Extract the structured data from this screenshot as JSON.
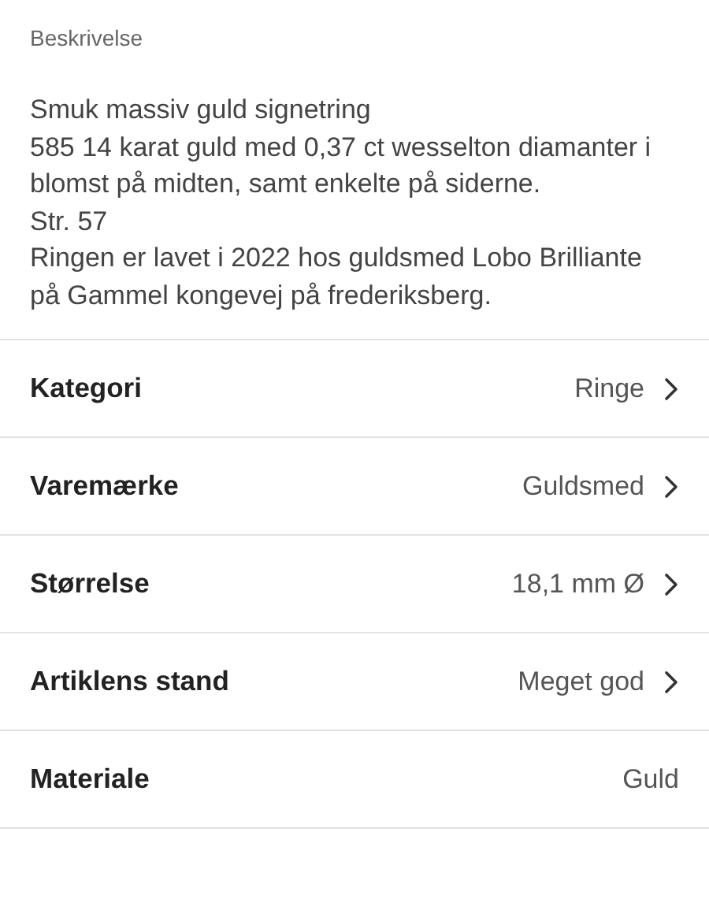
{
  "description": {
    "label": "Beskrivelse",
    "paragraphs": [
      "Smuk massiv guld signetring",
      "585 14 karat guld med 0,37 ct wesselton diamanter i blomst på midten, samt enkelte på siderne.",
      "Str. 57",
      "Ringen er lavet i 2022 hos guldsmed Lobo Brilliante på Gammel kongevej på frederiksberg."
    ]
  },
  "attributes": [
    {
      "kind": "link",
      "label": "Kategori",
      "value": "Ringe"
    },
    {
      "kind": "link",
      "label": "Varemærke",
      "value": "Guldsmed"
    },
    {
      "kind": "link",
      "label": "Størrelse",
      "value": "18,1 mm Ø"
    },
    {
      "kind": "link",
      "label": "Artiklens stand",
      "value": "Meget god"
    },
    {
      "kind": "plain",
      "label": "Materiale",
      "value": "Guld"
    }
  ]
}
